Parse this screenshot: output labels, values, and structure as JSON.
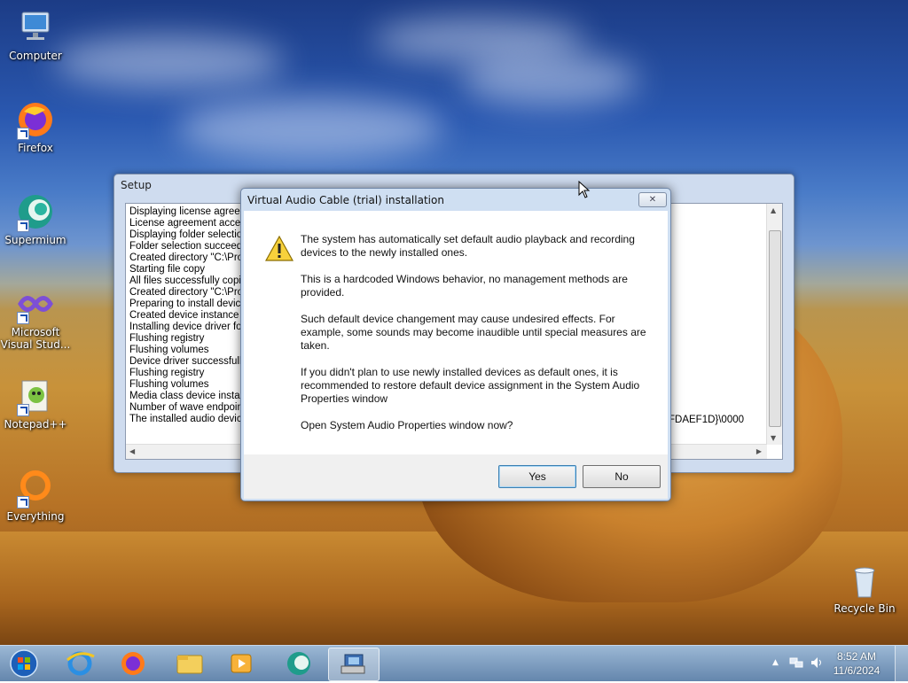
{
  "desktop": {
    "icons": [
      {
        "label": "Computer"
      },
      {
        "label": "Firefox"
      },
      {
        "label": "Supermium"
      },
      {
        "label": "Microsoft Visual Stud..."
      },
      {
        "label": "Notepad++"
      },
      {
        "label": "Everything"
      },
      {
        "label": "Recycle Bin"
      }
    ]
  },
  "setup_window": {
    "title": "Setup",
    "log_lines": [
      "Displaying license agreeme",
      "License agreement accept",
      "Displaying folder selection",
      "Folder selection succeeded",
      "Created directory \"C:\\Prog",
      "Starting file copy",
      "All files successfully copie",
      "Created directory \"C:\\Prog",
      "Preparing to install device",
      "Created device instance \"R",
      "Installing device driver for",
      "Flushing registry",
      "Flushing volumes",
      "Device driver successfully",
      "Flushing registry",
      "Flushing volumes",
      "Media class device installe",
      "Number of wave endpoint",
      "The installed audio device"
    ],
    "log_tail": "FDAEF1D}\\0000"
  },
  "dialog": {
    "title": "Virtual Audio Cable (trial) installation",
    "close_label": "✕",
    "paragraphs": [
      "The system has automatically set default audio playback and recording devices to the newly installed ones.",
      "This is a hardcoded Windows behavior, no management methods are provided.",
      "Such default device changement may cause undesired effects. For example, some sounds may become inaudible until special measures are taken.",
      "If you didn't plan to use newly installed devices as default ones, it is recommended to restore default device assignment in the System Audio Properties window",
      "Open System Audio Properties window now?"
    ],
    "yes_label": "Yes",
    "no_label": "No"
  },
  "taskbar": {
    "items": [
      "start-orb",
      "internet-explorer",
      "firefox",
      "file-explorer",
      "media-player",
      "supermium",
      "setup-installer"
    ],
    "clock_time": "8:52 AM",
    "clock_date": "11/6/2024",
    "tray_expand": "▲"
  }
}
